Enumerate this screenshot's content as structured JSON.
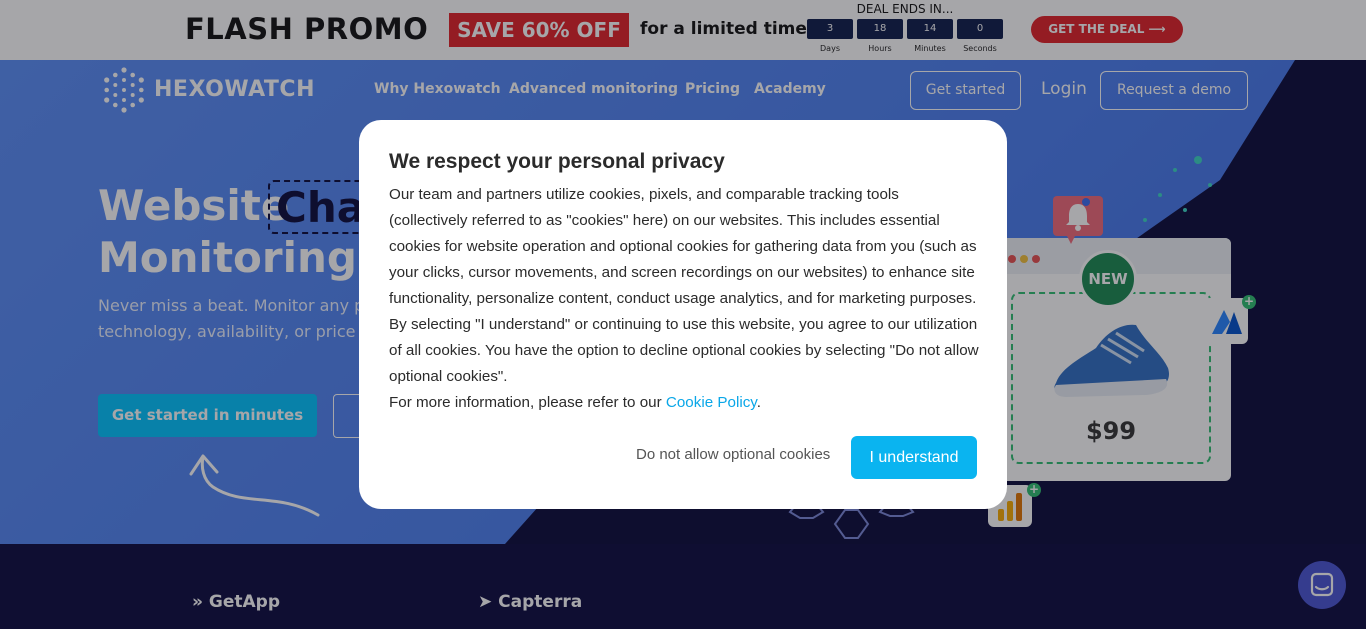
{
  "promo": {
    "title": "FLASH PROMO",
    "save": "SAVE 60% OFF",
    "subtitle": "for a limited time",
    "deal_label": "DEAL ENDS IN...",
    "countdown": [
      {
        "value": "3",
        "label": "Days"
      },
      {
        "value": "18",
        "label": "Hours"
      },
      {
        "value": "14",
        "label": "Minutes"
      },
      {
        "value": "0",
        "label": "Seconds"
      }
    ],
    "cta": "GET THE DEAL",
    "cta_icon": "arrow-right-icon",
    "colors": {
      "accent": "#e32127",
      "counter": "#0e1c4b"
    }
  },
  "nav": {
    "logo_text": "HEXOWATCH",
    "links": [
      "Why Hexowatch",
      "Advanced monitoring",
      "Pricing",
      "Academy"
    ],
    "get_started": "Get started",
    "login": "Login",
    "request_demo": "Request a demo"
  },
  "hero": {
    "title_part1": "Website",
    "title_highlight": "Char",
    "title_line2": "Monitoring &",
    "paragraph": "Never miss a beat. Monitor any p technology, availability, or price c",
    "cta": "Get started in minutes",
    "colors": {
      "cta": "#00c3ff",
      "hero_bg": "#4b7ef0",
      "dark_bg": "#0b0a3a"
    }
  },
  "illustration": {
    "badge": "NEW",
    "price": "$99"
  },
  "brands": [
    "GetApp",
    "Capterra"
  ],
  "chat": {
    "icon": "chat-icon"
  },
  "cookie_modal": {
    "title": "We respect your personal privacy",
    "body": "Our team and partners utilize cookies, pixels, and comparable tracking tools (collectively referred to as \"cookies\" here) on our websites. This includes essential cookies for website operation and optional cookies for gathering data from you (such as your clicks, cursor movements, and screen recordings on our websites) to enhance site functionality, personalize content, conduct usage analytics, and for marketing purposes. By selecting \"I understand\" or continuing to use this website, you agree to our utilization of all cookies. You have the option to decline optional cookies by selecting \"Do not allow optional cookies\".",
    "more_prefix": "For more information, please refer to our ",
    "more_link": "Cookie Policy",
    "more_suffix": ".",
    "decline": "Do not allow optional cookies",
    "accept": "I understand",
    "colors": {
      "accept": "#0ab4f0",
      "link": "#0aa7e8"
    }
  }
}
